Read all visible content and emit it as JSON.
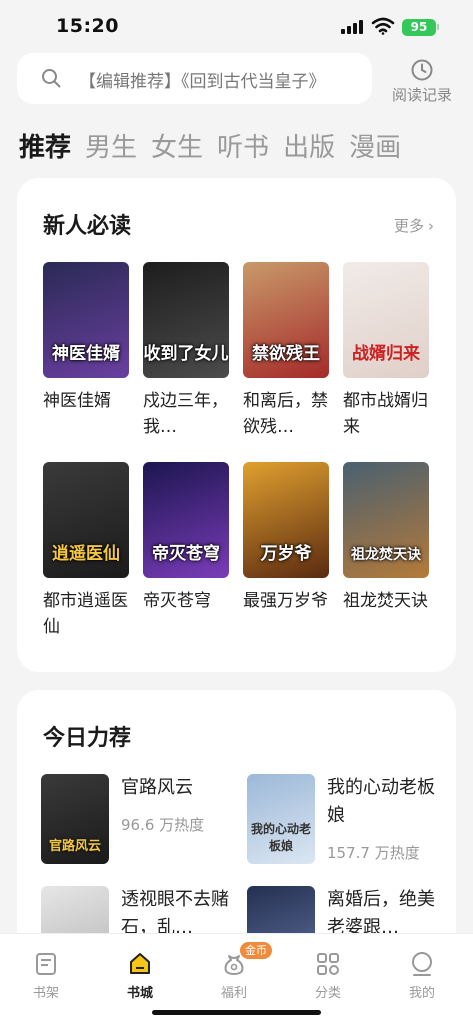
{
  "status_bar": {
    "time": "15:20",
    "battery": "95"
  },
  "search": {
    "placeholder": "【编辑推荐】《回到古代当皇子》"
  },
  "history": {
    "label": "阅读记录"
  },
  "tabs": [
    "推荐",
    "男生",
    "女生",
    "听书",
    "出版",
    "漫画"
  ],
  "new_reader": {
    "title": "新人必读",
    "more": "更多",
    "books": [
      {
        "name": "神医佳婿",
        "cover_text": "神医佳婿",
        "color1": "#2a2a55",
        "color2": "#6a3fa0"
      },
      {
        "name": "戍边三年，我…",
        "cover_text": "收到了女儿",
        "color1": "#1d1d1d",
        "color2": "#4c4c4c"
      },
      {
        "name": "和离后，禁欲残…",
        "cover_text": "禁欲残王",
        "color1": "#c89a6a",
        "color2": "#a52a2a"
      },
      {
        "name": "都市战婿归来",
        "cover_text": "战婿归来",
        "color1": "#f1ebe8",
        "color2": "#e0cfc8"
      },
      {
        "name": "都市逍遥医仙",
        "cover_text": "逍遥医仙",
        "color1": "#3a3a3a",
        "color2": "#1b1b1b"
      },
      {
        "name": "帝灭苍穹",
        "cover_text": "帝灭苍穹",
        "color1": "#1c1650",
        "color2": "#7a3cb8"
      },
      {
        "name": "最强万岁爷",
        "cover_text": "万岁爷",
        "color1": "#e0a030",
        "color2": "#5a2a10"
      },
      {
        "name": "祖龙焚天诀",
        "cover_text": "祖龙焚天诀",
        "color1": "#4a6070",
        "color2": "#b47a3a"
      }
    ]
  },
  "today": {
    "title": "今日力荐",
    "books": [
      {
        "name": "官路风云",
        "heat": "96.6 万热度",
        "cover_text": "官路风云",
        "color1": "#3a3a3a",
        "color2": "#1a1a1a"
      },
      {
        "name": "我的心动老板娘",
        "heat": "157.7 万热度",
        "cover_text": "我的心动老板娘",
        "color1": "#9cb8d8",
        "color2": "#dbe6f2"
      },
      {
        "name": "透视眼不去赌石，乱…",
        "heat": "",
        "cover_text": "",
        "color1": "#e6e6e6",
        "color2": "#b5b5b5"
      },
      {
        "name": "离婚后，绝美老婆跟…",
        "heat": "",
        "cover_text": "",
        "color1": "#243050",
        "color2": "#6070a0"
      }
    ]
  },
  "bottom_nav": {
    "items": [
      "书架",
      "书城",
      "福利",
      "分类",
      "我的"
    ],
    "active": 1,
    "badge": "金币"
  }
}
